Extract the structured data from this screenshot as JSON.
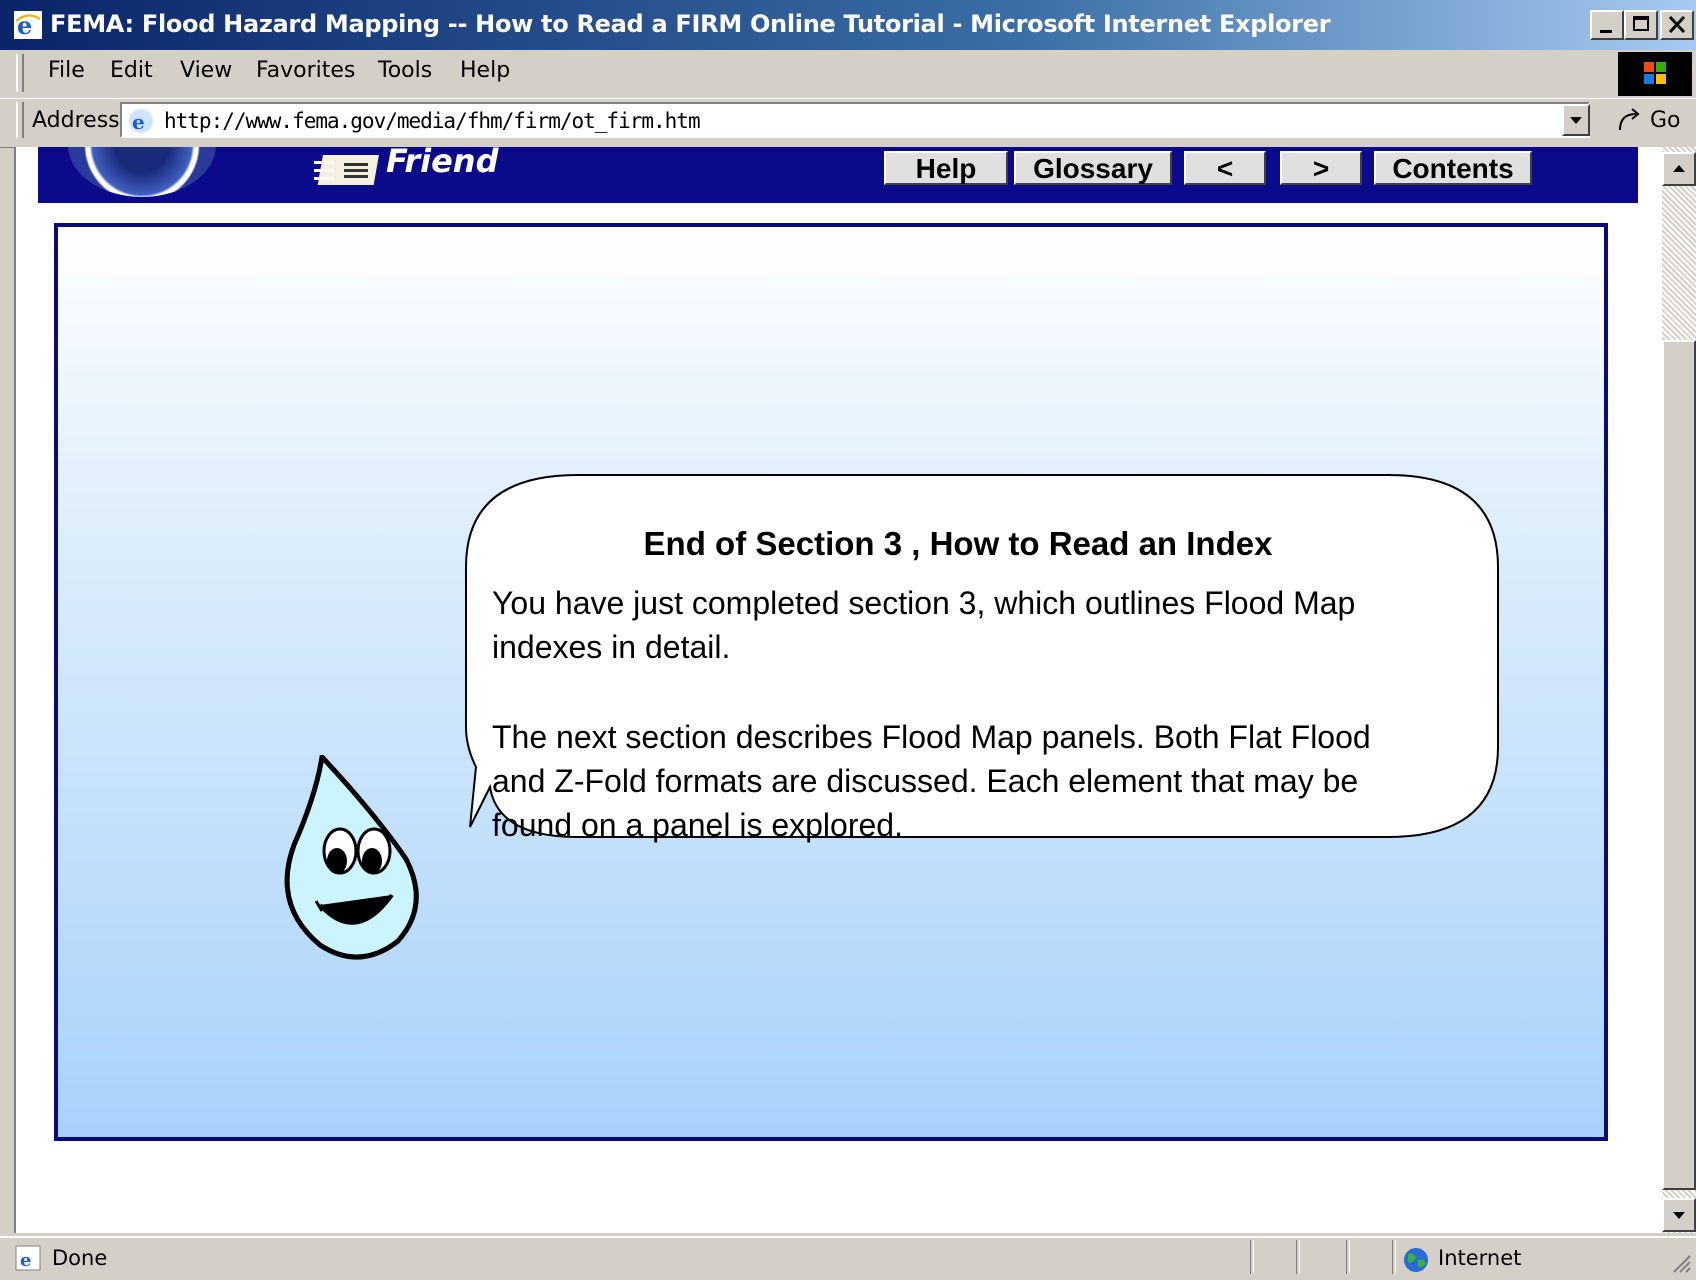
{
  "window": {
    "title": "FEMA: Flood Hazard Mapping -- How to Read a FIRM Online Tutorial - Microsoft Internet Explorer"
  },
  "menu": {
    "items": [
      {
        "label": "File"
      },
      {
        "label": "Edit"
      },
      {
        "label": "View"
      },
      {
        "label": "Favorites"
      },
      {
        "label": "Tools"
      },
      {
        "label": "Help"
      }
    ]
  },
  "address_bar": {
    "label": "Address",
    "url": "http://www.fema.gov/media/fhm/firm/ot_firm.htm",
    "go_label": "Go"
  },
  "page": {
    "tell_friend": "Friend",
    "nav_buttons": {
      "help": "Help",
      "glossary": "Glossary",
      "prev": "<",
      "next": ">",
      "contents": "Contents"
    },
    "bubble": {
      "title": "End of Section 3 , How to Read an Index",
      "paragraph1": "You have just completed section 3, which outlines Flood Map indexes in detail.",
      "paragraph2": "The next section describes Flood Map panels. Both Flat Flood and Z-Fold formats are discussed. Each element that may be found on a panel is explored."
    }
  },
  "status_bar": {
    "status": "Done",
    "zone": "Internet"
  },
  "colors": {
    "titlebar": "#0a246a",
    "header_strip": "#0a0a8a",
    "panel_border": "#0a0a7a",
    "chrome": "#d4d0c8"
  }
}
